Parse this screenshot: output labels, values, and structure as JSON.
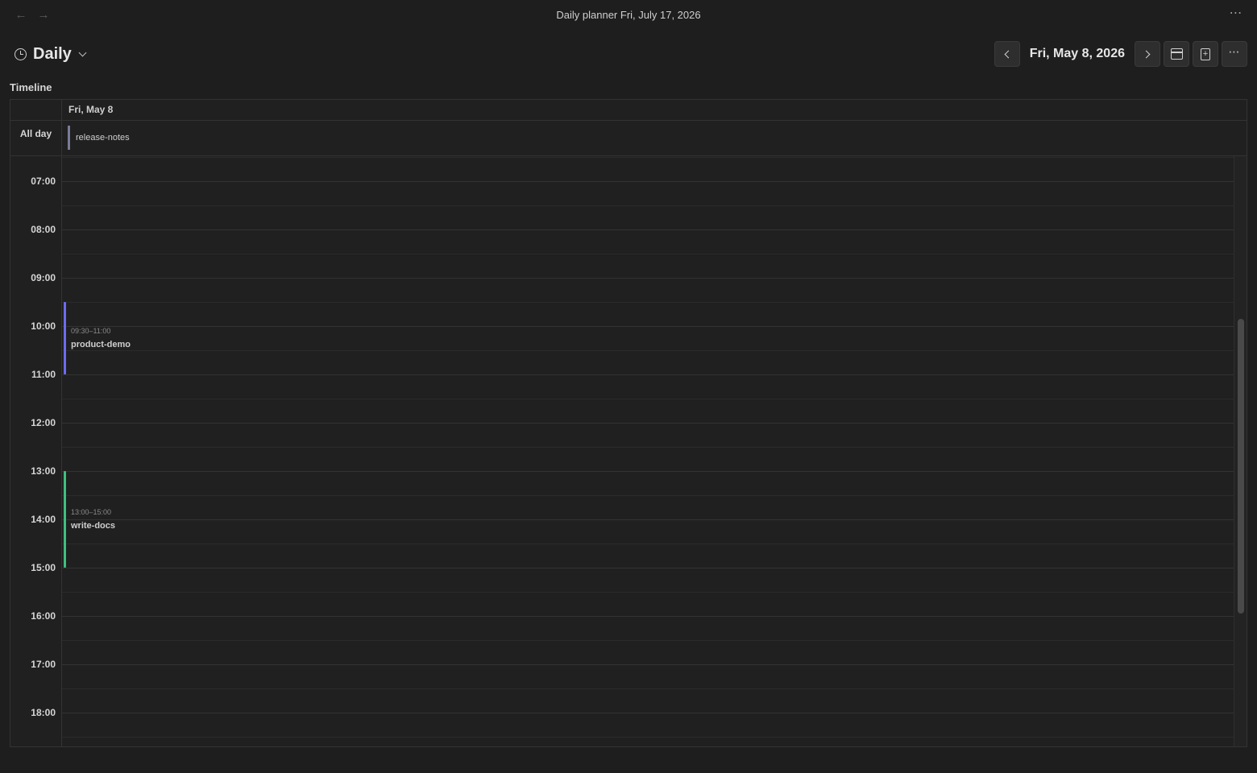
{
  "window": {
    "title": "Daily planner Fri, July 17, 2026",
    "back_icon": "arrow-left-icon",
    "forward_icon": "arrow-right-icon",
    "more_icon": "more-horizontal-icon"
  },
  "header": {
    "view_label": "Daily",
    "view_icon": "clock-icon",
    "date_label": "Fri, May 8, 2026",
    "prev_icon": "chevron-left-icon",
    "next_icon": "chevron-right-icon",
    "calendar_icon": "calendar-icon",
    "new_note_icon": "file-plus-icon",
    "menu_icon": "more-horizontal-icon"
  },
  "timeline": {
    "section_title": "Timeline",
    "day_header": "Fri, May 8",
    "allday_label": "All day",
    "allday_events": [
      {
        "title": "release-notes"
      }
    ],
    "hours": [
      "07:00",
      "08:00",
      "09:00",
      "10:00",
      "11:00",
      "12:00",
      "13:00",
      "14:00",
      "15:00",
      "16:00",
      "17:00",
      "18:00"
    ],
    "events": [
      {
        "time": "09:30–11:00",
        "title": "product-demo",
        "start": "09:30",
        "end": "11:00",
        "color": "#6c6cf0"
      },
      {
        "time": "13:00–15:00",
        "title": "write-docs",
        "start": "13:00",
        "end": "15:00",
        "color": "#3fbf7f"
      }
    ]
  },
  "colors": {
    "background": "#1e1e1e",
    "panel": "#202020",
    "border": "#333333",
    "text": "#dcddde"
  }
}
